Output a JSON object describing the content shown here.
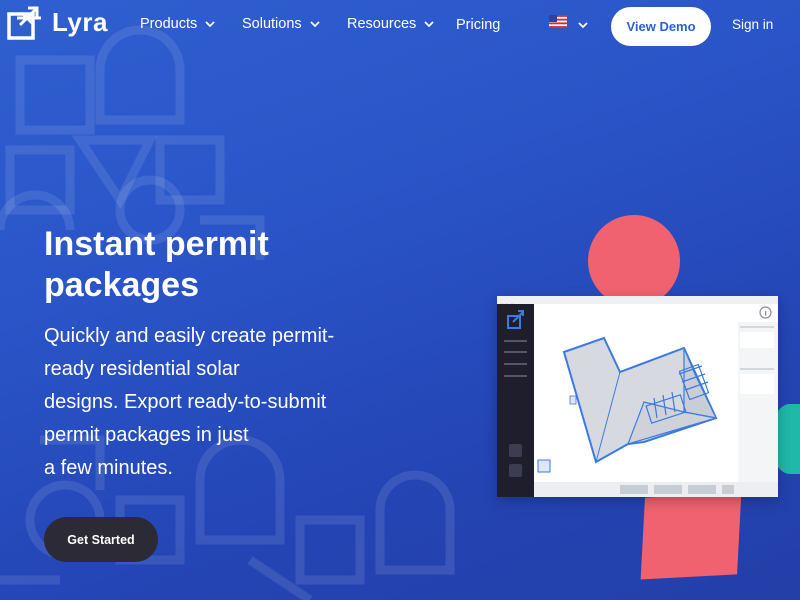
{
  "brand": {
    "name": "Lyra"
  },
  "nav": {
    "items": [
      {
        "label": "Products",
        "has_dropdown": true
      },
      {
        "label": "Solutions",
        "has_dropdown": true
      },
      {
        "label": "Resources",
        "has_dropdown": true
      },
      {
        "label": "Pricing",
        "has_dropdown": false
      }
    ],
    "language_icon": "us-flag-icon",
    "demo_label": "View Demo",
    "signin_label": "Sign in"
  },
  "hero": {
    "title": "Instant permit packages",
    "subtitle_lines": [
      "Quickly and easily create permit-",
      "ready residential solar",
      "designs. Export ready-to-submit",
      "permit packages in just",
      "a few minutes."
    ],
    "cta_label": "Get Started"
  },
  "colors": {
    "background": "#2a55c8",
    "accent_red": "#f06270",
    "accent_teal": "#20b8a8",
    "button_dark": "#2b2a35",
    "roof_blue": "#3b7be0"
  }
}
